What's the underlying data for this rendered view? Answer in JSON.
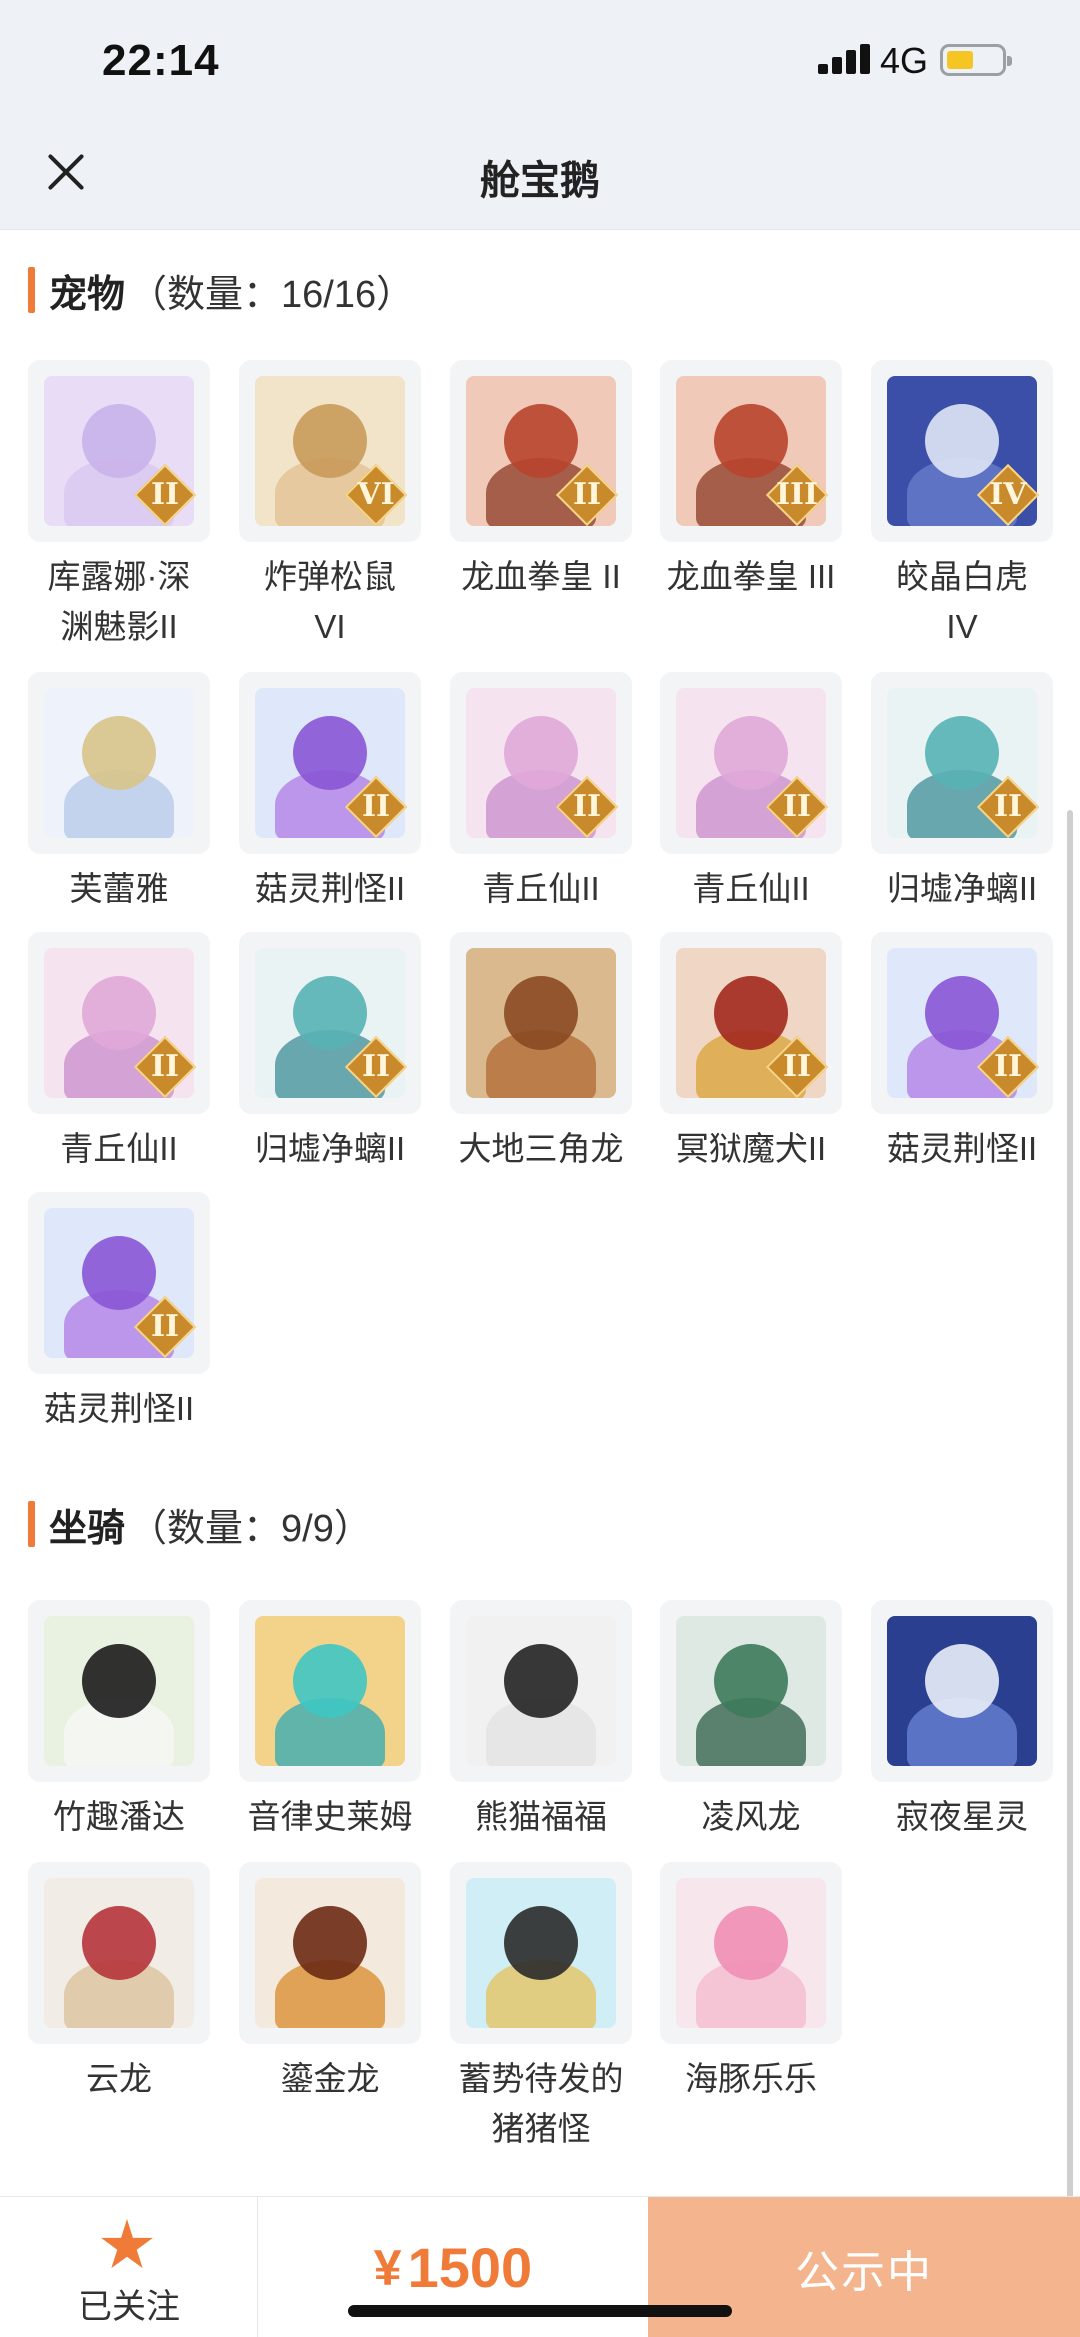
{
  "status_bar": {
    "time": "22:14",
    "network": "4G"
  },
  "header": {
    "title": "舱宝鹅"
  },
  "pets": {
    "title": "宠物",
    "count": "（数量：16/16）",
    "items": [
      {
        "name": "库露娜·深\n渊魅影II",
        "tier": "II",
        "colors": [
          "#e9dcf7",
          "#c9b3ea",
          "#d7c7f0"
        ]
      },
      {
        "name": "炸弹松鼠\nVI",
        "tier": "VI",
        "colors": [
          "#f2e4c9",
          "#c99a5a",
          "#e1c08f"
        ]
      },
      {
        "name": "龙血拳皇 II",
        "tier": "II",
        "colors": [
          "#f0c9b8",
          "#b8442c",
          "#8c3a24"
        ]
      },
      {
        "name": "龙血拳皇 III",
        "tier": "III",
        "colors": [
          "#f0c9b8",
          "#b8442c",
          "#8c3a24"
        ]
      },
      {
        "name": "皎晶白虎\nIV",
        "tier": "IV",
        "colors": [
          "#3c4fa8",
          "#dfe6f5",
          "#6b7fcf"
        ]
      },
      {
        "name": "芙蕾雅",
        "tier": "",
        "colors": [
          "#eef3fb",
          "#d8c48a",
          "#b6c8e8"
        ]
      },
      {
        "name": "菇灵荆怪II",
        "tier": "II",
        "colors": [
          "#dfe7fb",
          "#8a55d6",
          "#b07be6"
        ]
      },
      {
        "name": "青丘仙II",
        "tier": "II",
        "colors": [
          "#f5e3f0",
          "#e0a9d8",
          "#c88ccc"
        ]
      },
      {
        "name": "青丘仙II",
        "tier": "II",
        "colors": [
          "#f5e3f0",
          "#e0a9d8",
          "#c88ccc"
        ]
      },
      {
        "name": "归墟净螭II",
        "tier": "II",
        "colors": [
          "#e9f3f4",
          "#58b3b5",
          "#3e8e97"
        ]
      },
      {
        "name": "青丘仙II",
        "tier": "II",
        "colors": [
          "#f5e3f0",
          "#e0a9d8",
          "#c88ccc"
        ]
      },
      {
        "name": "归墟净螭II",
        "tier": "II",
        "colors": [
          "#e9f3f4",
          "#58b3b5",
          "#3e8e97"
        ]
      },
      {
        "name": "大地三角龙",
        "tier": "",
        "colors": [
          "#d9b98d",
          "#8a4a24",
          "#b06a33"
        ]
      },
      {
        "name": "冥狱魔犬II",
        "tier": "II",
        "colors": [
          "#f0d6c4",
          "#a3291e",
          "#d9a236"
        ]
      },
      {
        "name": "菇灵荆怪II",
        "tier": "II",
        "colors": [
          "#dfe7fb",
          "#8a55d6",
          "#b07be6"
        ]
      },
      {
        "name": "菇灵荆怪II",
        "tier": "II",
        "colors": [
          "#dfe7fb",
          "#8a55d6",
          "#b07be6"
        ]
      }
    ]
  },
  "mounts": {
    "title": "坐骑",
    "count": "（数量：9/9）",
    "items": [
      {
        "name": "竹趣潘达",
        "tier": "",
        "colors": [
          "#e9f1e0",
          "#1c1c1c",
          "#f7f7f7"
        ]
      },
      {
        "name": "音律史莱姆",
        "tier": "",
        "colors": [
          "#f3d28a",
          "#3fc5c2",
          "#2fa9b3"
        ]
      },
      {
        "name": "熊猫福福",
        "tier": "",
        "colors": [
          "#f1f1f1",
          "#222222",
          "#e2e2e2"
        ]
      },
      {
        "name": "凌风龙",
        "tier": "",
        "colors": [
          "#dfe9e4",
          "#3c7a5a",
          "#2d5e47"
        ]
      },
      {
        "name": "寂夜星灵",
        "tier": "",
        "colors": [
          "#2a3f8f",
          "#e8eef8",
          "#6b86d6"
        ]
      },
      {
        "name": "云龙",
        "tier": "",
        "colors": [
          "#f2ece6",
          "#b5343a",
          "#d9c09a"
        ]
      },
      {
        "name": "鎏金龙",
        "tier": "",
        "colors": [
          "#f3e9dc",
          "#6b2a14",
          "#d88a2a"
        ]
      },
      {
        "name": "蓄势待发的\n猪猪怪",
        "tier": "",
        "colors": [
          "#cfeef5",
          "#2a2a2a",
          "#e6c25a"
        ]
      },
      {
        "name": "海豚乐乐",
        "tier": "",
        "colors": [
          "#f7e7ec",
          "#ef8fb5",
          "#f4b9cf"
        ]
      }
    ]
  },
  "bottom_bar": {
    "follow_label": "已关注",
    "currency": "¥",
    "price": "1500",
    "action_label": "公示中"
  }
}
